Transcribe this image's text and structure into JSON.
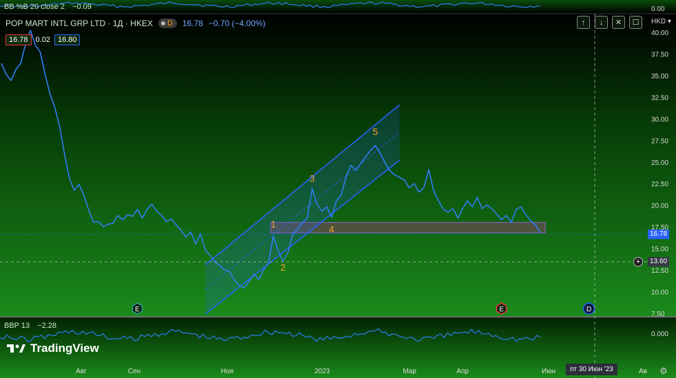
{
  "top_indicator": {
    "name": "BB %B 20 close 2",
    "value": "−0.09",
    "axis_label": "0.00"
  },
  "symbol": {
    "title": "POP MART INTL GRP LTD · 1Д · HKEX",
    "d_badge": "D",
    "last": "16.78",
    "change": "−0.70 (−4.00%)"
  },
  "ohlc": {
    "bid": "16.78",
    "spread": "0.02",
    "ask": "16.80"
  },
  "controls": [
    {
      "label": "↑",
      "name": "scroll-up-button"
    },
    {
      "label": "↓",
      "name": "scroll-down-button"
    },
    {
      "label": "✕",
      "name": "collapse-button"
    },
    {
      "label": "☐",
      "name": "maximize-button"
    }
  ],
  "currency": "HKD",
  "price_axis": [
    "40.00",
    "37.50",
    "35.00",
    "32.50",
    "30.00",
    "27.50",
    "25.00",
    "22.50",
    "20.00",
    "17.50",
    "15.00",
    "12.50",
    "10.00",
    "7.50"
  ],
  "current_price_tag": "16.78",
  "crosshair_price_tag": "13.60",
  "crosshair_date": "пт 30 Июн '23",
  "time_axis": [
    "Авг",
    "Сен",
    "Ноя",
    "2023",
    "Мар",
    "Апр",
    "Июн",
    "Ав"
  ],
  "bottom_indicator": {
    "name": "BBP 13",
    "value": "−2.28",
    "axis_label": "0.000"
  },
  "brand": "TradingView",
  "colors": {
    "price_line": "#2f7df6",
    "channel": "#2962ff",
    "wave_label": "#f0a030",
    "bg_top": "#000000",
    "bg_bottom": "#1b8a1b"
  },
  "chart_data": {
    "type": "line",
    "title": "POP MART INTL GRP LTD · 1Д · HKEX",
    "xlabel": "",
    "ylabel": "",
    "ylim": [
      7.5,
      41.5
    ],
    "x_ticks": [
      "Авг",
      "Сен",
      "Ноя",
      "2023",
      "Мар",
      "Апр",
      "Июн",
      "Ав"
    ],
    "series": [
      {
        "values": [
          36.5,
          35.2,
          34.5,
          35.8,
          36.5,
          38.8,
          40.3,
          38.6,
          37.8,
          35.2,
          33.0,
          31.4,
          29.2,
          26.0,
          23.2,
          21.8,
          22.5,
          21.2,
          19.5,
          18.1,
          18.2,
          17.6,
          17.9,
          18.0,
          18.9,
          18.4,
          19.0,
          18.8,
          19.6,
          18.6,
          19.6,
          20.2,
          19.4,
          18.9,
          18.2,
          18.5,
          17.8,
          17.2,
          16.4,
          17.0,
          15.6,
          16.8,
          14.9,
          14.3,
          13.5,
          13.1,
          12.6,
          12.4,
          11.4,
          10.8,
          10.5,
          11.3,
          12.1,
          11.5,
          12.6,
          13.4,
          16.5,
          14.8,
          13.6,
          14.6,
          16.7,
          17.3,
          18.1,
          18.6,
          22.0,
          20.2,
          19.4,
          19.9,
          18.7,
          20.6,
          21.3,
          23.4,
          24.7,
          24.1,
          24.9,
          25.7,
          26.4,
          27.0,
          26.1,
          25.0,
          24.1,
          23.6,
          23.3,
          23.0,
          22.1,
          22.6,
          21.6,
          22.1,
          24.2,
          21.8,
          20.6,
          19.6,
          19.3,
          19.7,
          18.6,
          19.7,
          20.6,
          19.9,
          21.0,
          19.7,
          20.1,
          19.7,
          19.1,
          18.4,
          18.9,
          18.1,
          19.6,
          19.9,
          19.0,
          18.3,
          17.8,
          16.9
        ]
      }
    ],
    "annotations": {
      "wave_labels": [
        {
          "label": "1",
          "x_index": 56,
          "y": 17.5
        },
        {
          "label": "2",
          "x_index": 58,
          "y": 12.5
        },
        {
          "label": "3",
          "x_index": 64,
          "y": 22.8
        },
        {
          "label": "4",
          "x_index": 68,
          "y": 16.9
        },
        {
          "label": "5",
          "x_index": 77,
          "y": 28.2
        }
      ],
      "zone": {
        "y_low": 16.9,
        "y_high": 18.1,
        "x_start_index": 56,
        "x_end_index": 112
      },
      "channel": {
        "x_start_index": 42,
        "x_end_index": 82,
        "upper": [
          13.2,
          31.7
        ],
        "lower": [
          7.5,
          25.3
        ]
      },
      "event_markers": [
        {
          "label": "E",
          "x_index": 28,
          "color": "#26a69a"
        },
        {
          "label": "E",
          "x_index": 103,
          "color": "#f23645"
        },
        {
          "label": "D",
          "x_index": 121,
          "color": "#2962ff"
        }
      ]
    }
  }
}
